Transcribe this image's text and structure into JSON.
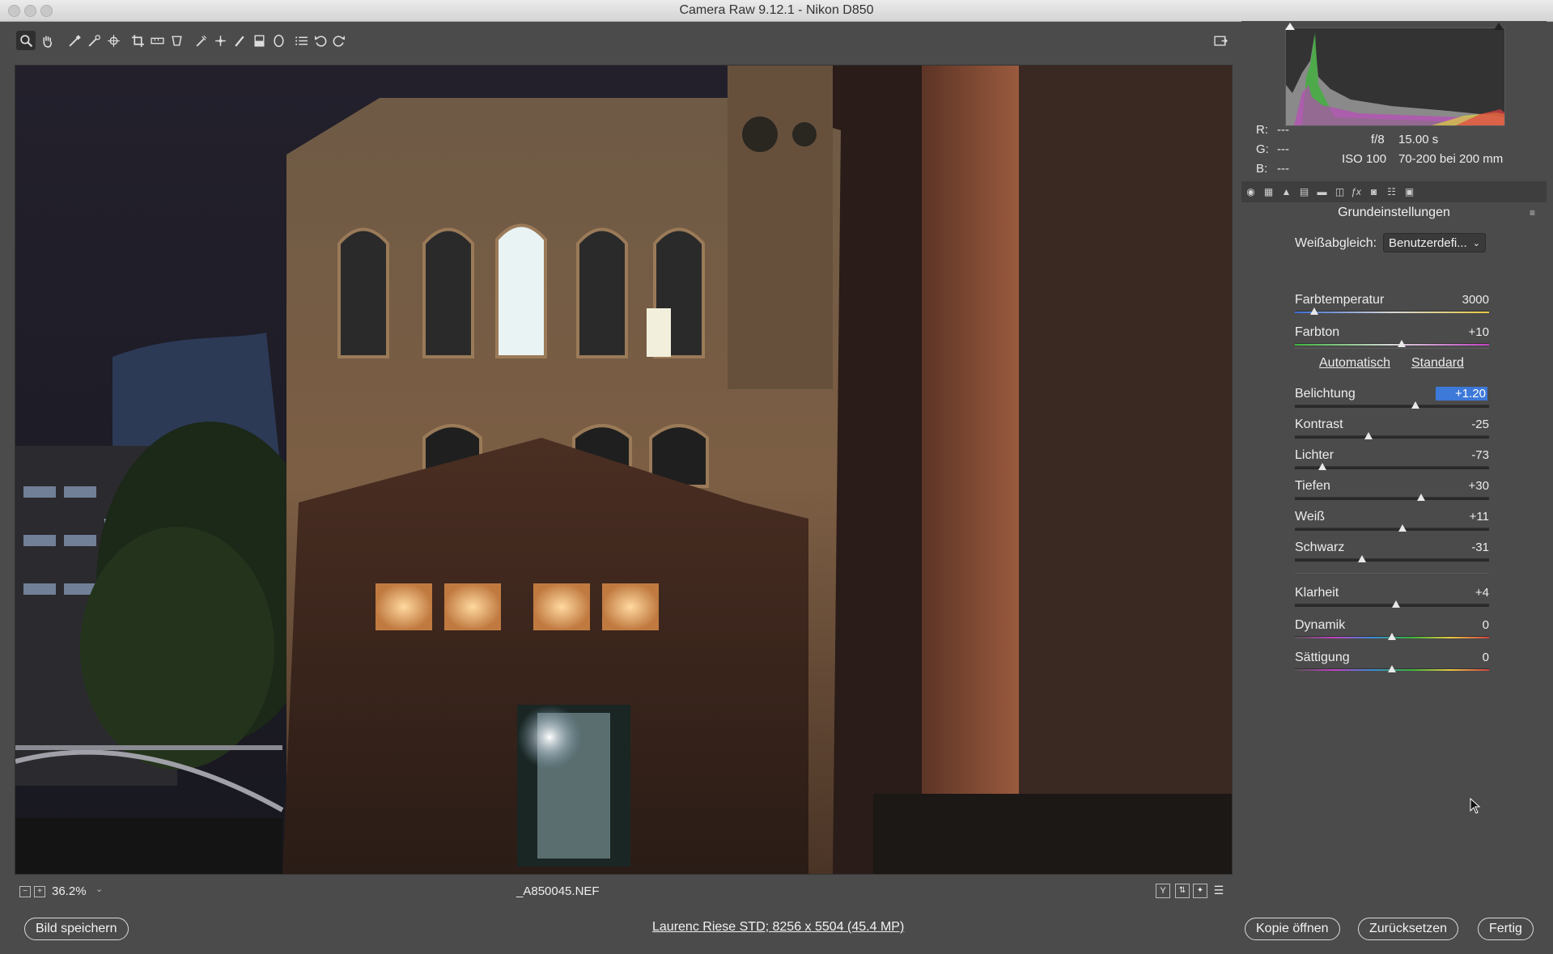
{
  "window": {
    "title": "Camera Raw 9.12.1  -  Nikon D850"
  },
  "toolbar": {
    "tools": [
      "zoom-tool",
      "hand-tool",
      "white-balance-tool",
      "color-sampler-tool",
      "targeted-adjustment-tool",
      "crop-tool",
      "straighten-tool",
      "transform-tool",
      "spot-removal-tool",
      "red-eye-tool",
      "adjustment-brush-tool",
      "graduated-filter-tool",
      "radial-filter-tool",
      "presets-list-tool",
      "rotate-ccw-tool",
      "rotate-cw-tool"
    ]
  },
  "preview": {
    "filename": "_A850045.NEF",
    "zoom": "36.2%"
  },
  "info": {
    "r_label": "R:",
    "r_value": "---",
    "g_label": "G:",
    "g_value": "---",
    "b_label": "B:",
    "b_value": "---",
    "aperture": "f/8",
    "shutter": "15.00 s",
    "iso": "ISO 100",
    "lens": "70-200 bei 200 mm"
  },
  "panel": {
    "title": "Grundeinstellungen",
    "wb_label": "Weißabgleich:",
    "wb_value": "Benutzerdefi...",
    "auto_link": "Automatisch",
    "default_link": "Standard",
    "sliders": [
      {
        "label": "Farbtemperatur",
        "value": "3000",
        "pos": 0.1
      },
      {
        "label": "Farbton",
        "value": "+10",
        "pos": 0.55
      },
      {
        "label": "Belichtung",
        "value": "+1.20",
        "pos": 0.62
      },
      {
        "label": "Kontrast",
        "value": "-25",
        "pos": 0.38
      },
      {
        "label": "Lichter",
        "value": "-73",
        "pos": 0.14
      },
      {
        "label": "Tiefen",
        "value": "+30",
        "pos": 0.65
      },
      {
        "label": "Weiß",
        "value": "+11",
        "pos": 0.555
      },
      {
        "label": "Schwarz",
        "value": "-31",
        "pos": 0.345
      },
      {
        "label": "Klarheit",
        "value": "+4",
        "pos": 0.52
      },
      {
        "label": "Dynamik",
        "value": "0",
        "pos": 0.5
      },
      {
        "label": "Sättigung",
        "value": "0",
        "pos": 0.5
      }
    ]
  },
  "bottom": {
    "save_label": "Bild speichern",
    "workflow_link": "Laurenc Riese STD; 8256 x 5504 (45.4 MP)",
    "open_copy_label": "Kopie öffnen",
    "reset_label": "Zurücksetzen",
    "done_label": "Fertig"
  },
  "colors": {
    "accent": "#3d79d9",
    "panel_bg": "#4b4b4b",
    "canvas_bg": "#1d1d1d"
  }
}
